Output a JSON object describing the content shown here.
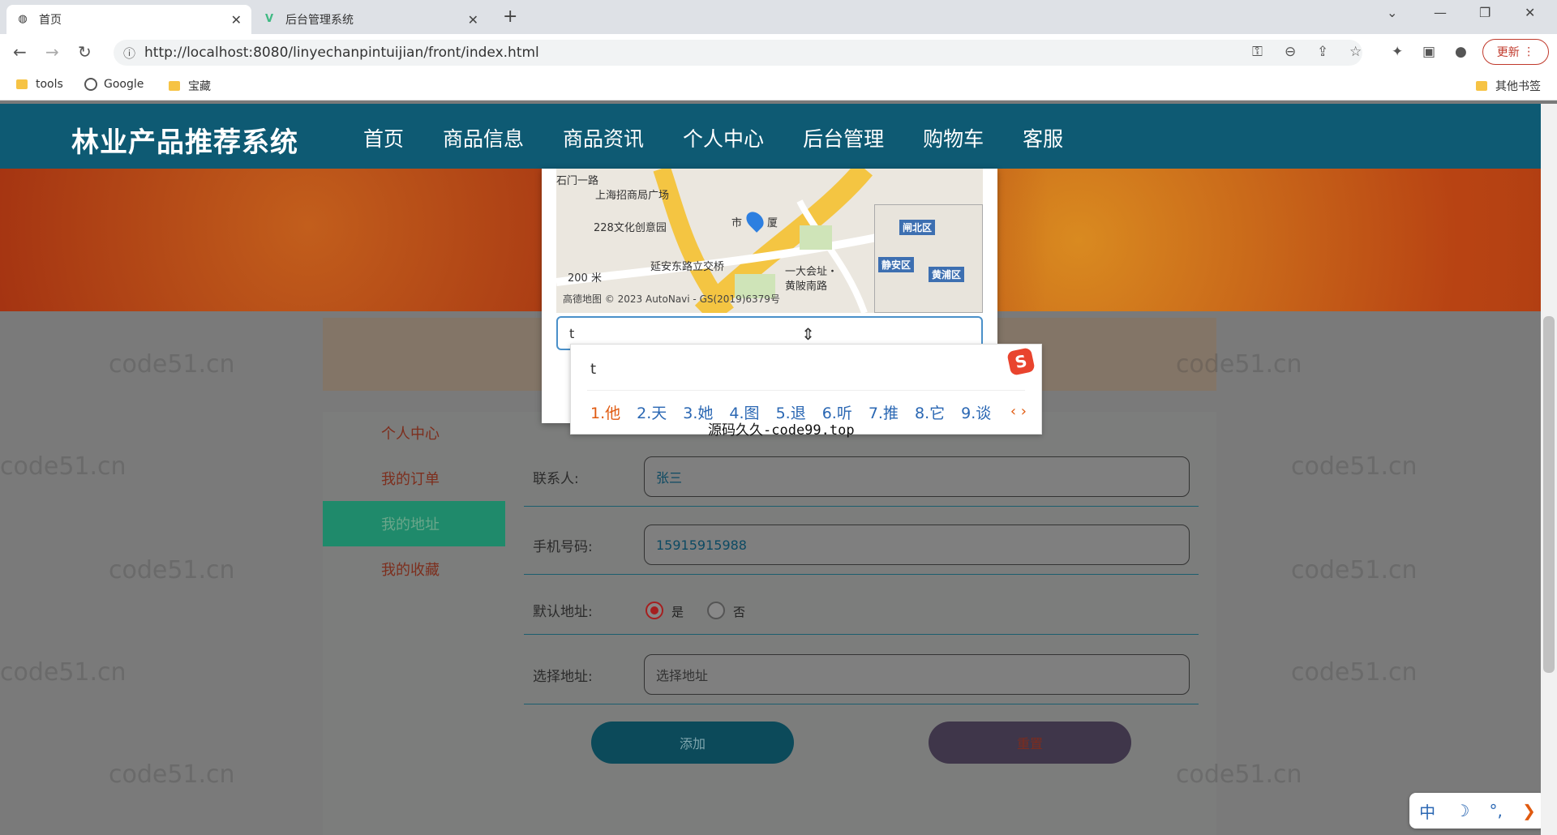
{
  "browser": {
    "tabs": [
      {
        "title": "首页",
        "active": true
      },
      {
        "title": "后台管理系统",
        "active": false
      }
    ],
    "url": "http://localhost:8080/linyechanpintuijian/front/index.html",
    "update_label": "更新",
    "bookmarks": [
      {
        "label": "tools",
        "icon": "folder-icon"
      },
      {
        "label": "Google",
        "icon": "globe-icon"
      },
      {
        "label": "宝藏",
        "icon": "folder-icon"
      }
    ],
    "other_bookmarks": "其他书签"
  },
  "site": {
    "brand": "林业产品推荐系统",
    "nav": [
      "首页",
      "商品信息",
      "商品资讯",
      "个人中心",
      "后台管理",
      "购物车",
      "客服"
    ]
  },
  "sidebar": {
    "items": [
      {
        "label": "个人中心",
        "active": false
      },
      {
        "label": "我的订单",
        "active": false
      },
      {
        "label": "我的地址",
        "active": true
      },
      {
        "label": "我的收藏",
        "active": false
      }
    ]
  },
  "form": {
    "contact_label": "联系人:",
    "contact_value": "张三",
    "phone_label": "手机号码:",
    "phone_value": "15915915988",
    "default_label": "默认地址:",
    "default_yes": "是",
    "default_no": "否",
    "address_label": "选择地址:",
    "address_placeholder": "选择地址",
    "add_button": "添加",
    "reset_button": "重置"
  },
  "map": {
    "labels": [
      "上海招商局广场",
      "228文化创意园",
      "市",
      "厦",
      "延安东路立交桥",
      "一大会址・",
      "黄陂南路",
      "200 米",
      "石门一路"
    ],
    "footer": "高德地图 © 2023 AutoNavi - GS(2019)6379号",
    "minimap_districts": [
      "闸北区",
      "静安区",
      "黄浦区"
    ],
    "input_value": "t"
  },
  "ime": {
    "composition": "t",
    "candidates": [
      "1.他",
      "2.天",
      "3.她",
      "4.图",
      "5.退",
      "6.听",
      "7.推",
      "8.它",
      "9.谈"
    ],
    "overlay_text": "源码久久-code99.top",
    "status": [
      "中",
      "☽",
      "°,",
      "❯"
    ]
  },
  "watermark": "code51.cn"
}
